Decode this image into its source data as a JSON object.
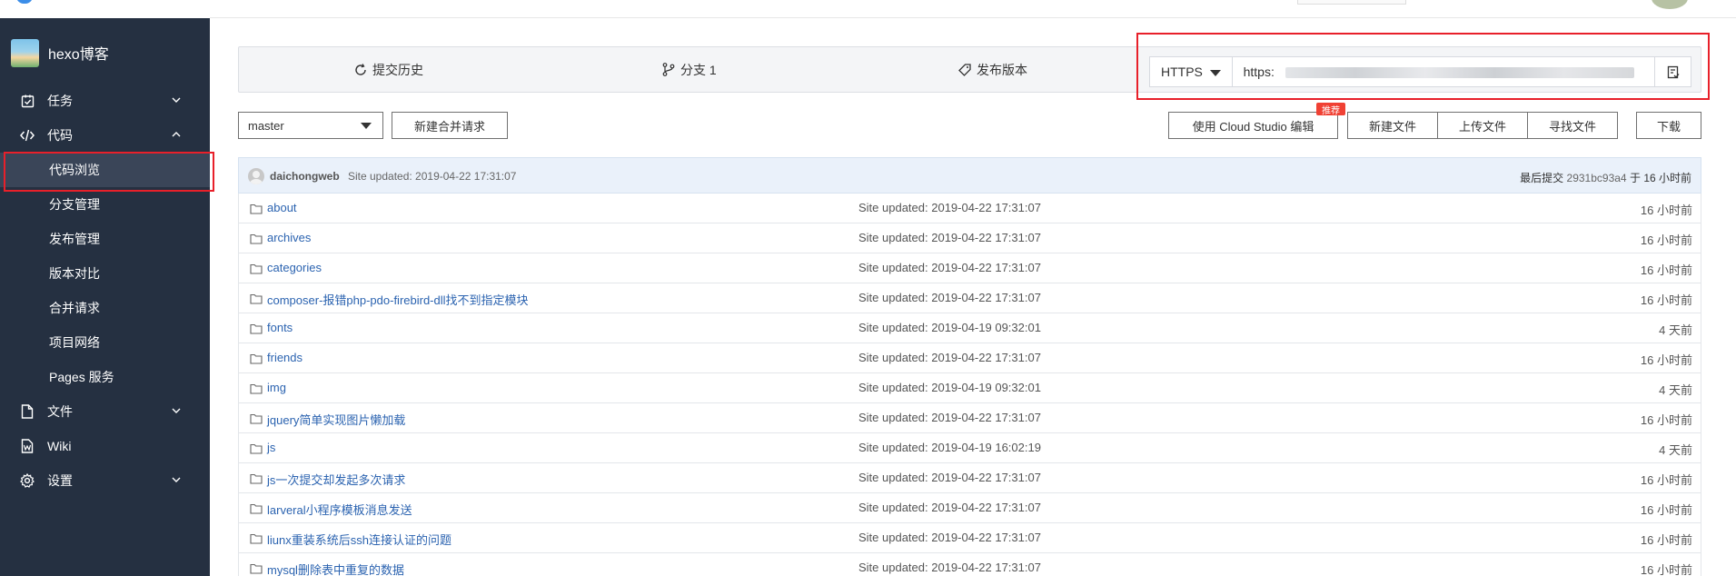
{
  "project": {
    "name": "hexo博客"
  },
  "sidebar": {
    "items": [
      {
        "label": "任务",
        "icon": "checkbox-icon",
        "chevron": "down"
      },
      {
        "label": "代码",
        "icon": "code-icon",
        "chevron": "up"
      },
      {
        "label": "文件",
        "icon": "file-icon",
        "chevron": "down"
      },
      {
        "label": "Wiki",
        "icon": "wiki-icon",
        "chevron": ""
      },
      {
        "label": "设置",
        "icon": "gear-icon",
        "chevron": "down"
      }
    ],
    "code_sub": [
      "代码浏览",
      "分支管理",
      "发布管理",
      "版本对比",
      "合并请求",
      "项目网络",
      "Pages 服务"
    ],
    "active_sub": "代码浏览"
  },
  "actions": {
    "history": "提交历史",
    "branches": "分支 1",
    "releases": "发布版本"
  },
  "clone": {
    "protocol": "HTTPS",
    "url_prefix": "https:"
  },
  "toolbar": {
    "branch": "master",
    "new_merge_request": "新建合并请求",
    "cloud_studio": "使用 Cloud Studio 编辑",
    "badge": "推荐",
    "new_file": "新建文件",
    "upload_file": "上传文件",
    "find_file": "寻找文件",
    "download": "下载"
  },
  "latest_commit": {
    "author": "daichongweb",
    "message": "Site updated: 2019-04-22 17:31:07",
    "last_label": "最后提交",
    "hash": "2931bc93a4",
    "at": "于",
    "time": "16 小时前"
  },
  "files": [
    {
      "name": "about",
      "message": "Site updated: 2019-04-22 17:31:07",
      "time": "16 小时前"
    },
    {
      "name": "archives",
      "message": "Site updated: 2019-04-22 17:31:07",
      "time": "16 小时前"
    },
    {
      "name": "categories",
      "message": "Site updated: 2019-04-22 17:31:07",
      "time": "16 小时前"
    },
    {
      "name": "composer-报错php-pdo-firebird-dll找不到指定模块",
      "message": "Site updated: 2019-04-22 17:31:07",
      "time": "16 小时前"
    },
    {
      "name": "fonts",
      "message": "Site updated: 2019-04-19 09:32:01",
      "time": "4 天前"
    },
    {
      "name": "friends",
      "message": "Site updated: 2019-04-22 17:31:07",
      "time": "16 小时前"
    },
    {
      "name": "img",
      "message": "Site updated: 2019-04-19 09:32:01",
      "time": "4 天前"
    },
    {
      "name": "jquery简单实现图片懒加载",
      "message": "Site updated: 2019-04-22 17:31:07",
      "time": "16 小时前"
    },
    {
      "name": "js",
      "message": "Site updated: 2019-04-19 16:02:19",
      "time": "4 天前"
    },
    {
      "name": "js一次提交却发起多次请求",
      "message": "Site updated: 2019-04-22 17:31:07",
      "time": "16 小时前"
    },
    {
      "name": "larveral小程序模板消息发送",
      "message": "Site updated: 2019-04-22 17:31:07",
      "time": "16 小时前"
    },
    {
      "name": "liunx重装系统后ssh连接认证的问题",
      "message": "Site updated: 2019-04-22 17:31:07",
      "time": "16 小时前"
    },
    {
      "name": "mysql删除表中重复的数据",
      "message": "Site updated: 2019-04-22 17:31:07",
      "time": "16 小时前"
    }
  ],
  "colors": {
    "sidebar_bg": "#253041",
    "active_bg": "#3a4558",
    "highlight": "#e8202a",
    "link": "#2b63b0",
    "badge": "#f04134"
  }
}
